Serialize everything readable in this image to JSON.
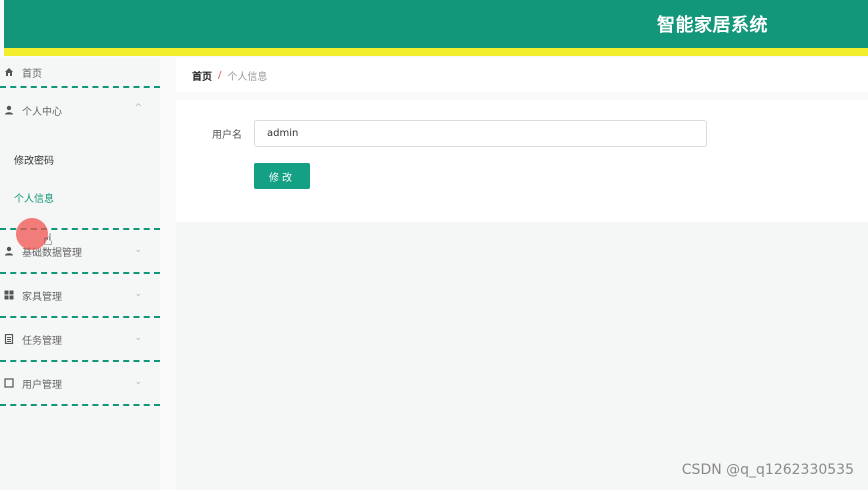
{
  "header": {
    "title": "智能家居系统",
    "bg_color": "#13977a",
    "stripe_color": "#f2ee2e"
  },
  "sidebar": {
    "home": {
      "label": "首页",
      "icon": "home-icon"
    },
    "personal_center": {
      "label": "个人中心",
      "icon": "user-icon",
      "expanded": true,
      "items": [
        {
          "label": "修改密码"
        },
        {
          "label": "个人信息",
          "active": true
        }
      ]
    },
    "items": [
      {
        "label": "基础数据管理",
        "icon": "user-icon"
      },
      {
        "label": "家具管理",
        "icon": "grid-icon"
      },
      {
        "label": "任务管理",
        "icon": "document-icon"
      },
      {
        "label": "用户管理",
        "icon": "square-icon"
      }
    ]
  },
  "breadcrumb": {
    "home": "首页",
    "separator": "/",
    "current": "个人信息"
  },
  "form": {
    "username_label": "用户名",
    "username_value": "admin",
    "submit_label": "修改"
  },
  "watermark": "CSDN @q_q1262330535"
}
